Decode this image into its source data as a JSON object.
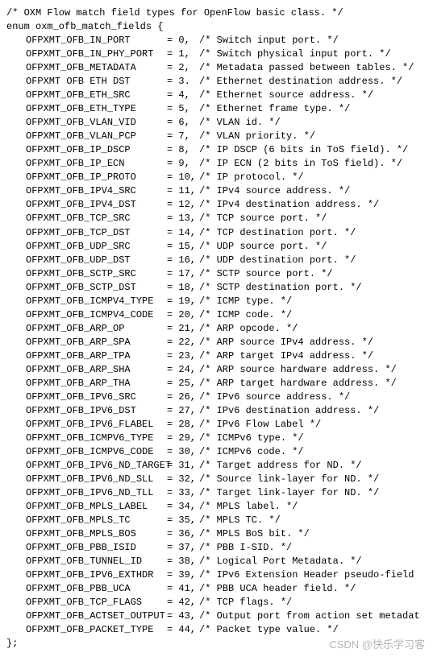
{
  "header_comment": "/* OXM Flow match field types for OpenFlow basic class. */",
  "enum_decl": "enum oxm_ofb_match_fields {",
  "enum_close": "};",
  "watermark": "CSDN @快乐学习客",
  "fields": [
    {
      "name": "OFPXMT_OFB_IN_PORT",
      "value": "= 0,",
      "comment": "/* Switch input port. */"
    },
    {
      "name": "OFPXMT_OFB_IN_PHY_PORT",
      "value": "= 1,",
      "comment": "/* Switch physical input port. */"
    },
    {
      "name": "OFPXMT_OFB_METADATA",
      "value": "= 2,",
      "comment": "/* Metadata passed between tables. */"
    },
    {
      "name": "OFPXMT OFB ETH DST",
      "value": "= 3.",
      "comment": "/* Ethernet destination address. */"
    },
    {
      "name": "OFPXMT_OFB_ETH_SRC",
      "value": "= 4,",
      "comment": "/* Ethernet source address. */"
    },
    {
      "name": "OFPXMT_OFB_ETH_TYPE",
      "value": "= 5,",
      "comment": "/* Ethernet frame type. */"
    },
    {
      "name": "OFPXMT_OFB_VLAN_VID",
      "value": "= 6,",
      "comment": "/* VLAN id. */"
    },
    {
      "name": "OFPXMT_OFB_VLAN_PCP",
      "value": "= 7,",
      "comment": "/* VLAN priority. */"
    },
    {
      "name": "OFPXMT_OFB_IP_DSCP",
      "value": "= 8,",
      "comment": "/* IP DSCP (6 bits in ToS field). */"
    },
    {
      "name": "OFPXMT_OFB_IP_ECN",
      "value": "= 9,",
      "comment": "/* IP ECN (2 bits in ToS field). */"
    },
    {
      "name": "OFPXMT_OFB_IP_PROTO",
      "value": "= 10,",
      "comment": "/* IP protocol. */"
    },
    {
      "name": "OFPXMT_OFB_IPV4_SRC",
      "value": "= 11,",
      "comment": "/* IPv4 source address. */"
    },
    {
      "name": "OFPXMT_OFB_IPV4_DST",
      "value": "= 12,",
      "comment": "/* IPv4 destination address. */"
    },
    {
      "name": "OFPXMT_OFB_TCP_SRC",
      "value": "= 13,",
      "comment": "/* TCP source port. */"
    },
    {
      "name": "OFPXMT_OFB_TCP_DST",
      "value": "= 14,",
      "comment": "/* TCP destination port. */"
    },
    {
      "name": "OFPXMT_OFB_UDP_SRC",
      "value": "= 15,",
      "comment": "/* UDP source port. */"
    },
    {
      "name": "OFPXMT_OFB_UDP_DST",
      "value": "= 16,",
      "comment": "/* UDP destination port. */"
    },
    {
      "name": "OFPXMT_OFB_SCTP_SRC",
      "value": "= 17,",
      "comment": "/* SCTP source port. */"
    },
    {
      "name": "OFPXMT_OFB_SCTP_DST",
      "value": "= 18,",
      "comment": "/* SCTP destination port. */"
    },
    {
      "name": "OFPXMT_OFB_ICMPV4_TYPE",
      "value": "= 19,",
      "comment": "/* ICMP type. */"
    },
    {
      "name": "OFPXMT_OFB_ICMPV4_CODE",
      "value": "= 20,",
      "comment": "/* ICMP code. */"
    },
    {
      "name": "OFPXMT_OFB_ARP_OP",
      "value": "= 21,",
      "comment": "/* ARP opcode. */"
    },
    {
      "name": "OFPXMT_OFB_ARP_SPA",
      "value": "= 22,",
      "comment": "/* ARP source IPv4 address. */"
    },
    {
      "name": "OFPXMT_OFB_ARP_TPA",
      "value": "= 23,",
      "comment": "/* ARP target IPv4 address. */"
    },
    {
      "name": "OFPXMT_OFB_ARP_SHA",
      "value": "= 24,",
      "comment": "/* ARP source hardware address. */"
    },
    {
      "name": "OFPXMT_OFB_ARP_THA",
      "value": "= 25,",
      "comment": "/* ARP target hardware address. */"
    },
    {
      "name": "OFPXMT_OFB_IPV6_SRC",
      "value": "= 26,",
      "comment": "/* IPv6 source address. */"
    },
    {
      "name": "OFPXMT_OFB_IPV6_DST",
      "value": "= 27,",
      "comment": "/* IPv6 destination address. */"
    },
    {
      "name": "OFPXMT_OFB_IPV6_FLABEL",
      "value": "= 28,",
      "comment": "/* IPv6 Flow Label */"
    },
    {
      "name": "OFPXMT_OFB_ICMPV6_TYPE",
      "value": "= 29,",
      "comment": "/* ICMPv6 type. */"
    },
    {
      "name": "OFPXMT_OFB_ICMPV6_CODE",
      "value": "= 30,",
      "comment": "/* ICMPv6 code. */"
    },
    {
      "name": "OFPXMT_OFB_IPV6_ND_TARGET",
      "value": "= 31,",
      "comment": "/* Target address for ND. */"
    },
    {
      "name": "OFPXMT_OFB_IPV6_ND_SLL",
      "value": "= 32,",
      "comment": "/* Source link-layer for ND. */"
    },
    {
      "name": "OFPXMT_OFB_IPV6_ND_TLL",
      "value": "= 33,",
      "comment": "/* Target link-layer for ND. */"
    },
    {
      "name": "OFPXMT_OFB_MPLS_LABEL",
      "value": "= 34,",
      "comment": "/* MPLS label. */"
    },
    {
      "name": "OFPXMT_OFB_MPLS_TC",
      "value": "= 35,",
      "comment": "/* MPLS TC. */"
    },
    {
      "name": "OFPXMT_OFB_MPLS_BOS",
      "value": "= 36,",
      "comment": "/* MPLS BoS bit. */"
    },
    {
      "name": "OFPXMT_OFB_PBB_ISID",
      "value": "= 37,",
      "comment": "/* PBB I-SID. */"
    },
    {
      "name": "OFPXMT_OFB_TUNNEL_ID",
      "value": "= 38,",
      "comment": "/* Logical Port Metadata. */"
    },
    {
      "name": "OFPXMT_OFB_IPV6_EXTHDR",
      "value": "= 39,",
      "comment": "/* IPv6 Extension Header pseudo-field"
    },
    {
      "name": "OFPXMT_OFB_PBB_UCA",
      "value": "= 41,",
      "comment": "/* PBB UCA header field. */"
    },
    {
      "name": "OFPXMT_OFB_TCP_FLAGS",
      "value": "= 42,",
      "comment": "/* TCP flags. */"
    },
    {
      "name": "OFPXMT_OFB_ACTSET_OUTPUT",
      "value": "= 43,",
      "comment": "/* Output port from action set metadat"
    },
    {
      "name": "OFPXMT_OFB_PACKET_TYPE",
      "value": "= 44,",
      "comment": "/* Packet type value. */"
    }
  ]
}
